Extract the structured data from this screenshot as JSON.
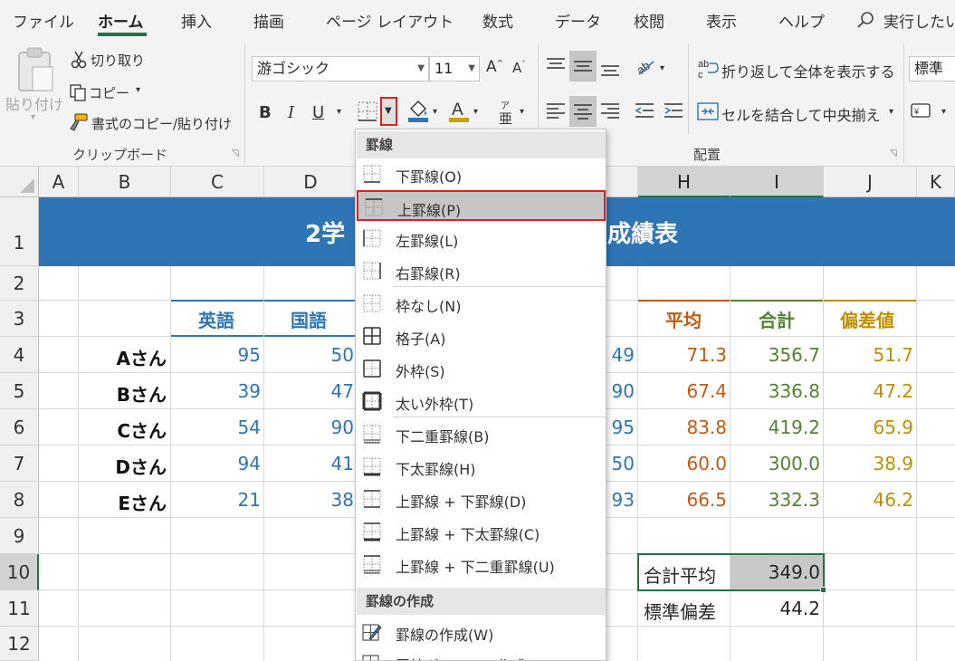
{
  "menu": {
    "tabs": [
      "ファイル",
      "ホーム",
      "挿入",
      "描画",
      "ページ レイアウト",
      "数式",
      "データ",
      "校閲",
      "表示",
      "ヘルプ"
    ],
    "active_tab": "ホーム",
    "tell_me": "実行したい"
  },
  "ribbon": {
    "clipboard": {
      "paste": "貼り付け",
      "cut": "切り取り",
      "copy": "コピー",
      "format_painter": "書式のコピー/貼り付け",
      "group_label": "クリップボード"
    },
    "font": {
      "name": "游ゴシック",
      "size": "11",
      "bold": "B",
      "italic": "I",
      "underline": "U",
      "phonetic": "亜"
    },
    "alignment": {
      "wrap_text": "折り返して全体を表示する",
      "merge_center": "セルを結合して中央揃え",
      "group_label": "配置"
    },
    "number": {
      "format": "標準"
    }
  },
  "columns": [
    "A",
    "B",
    "C",
    "D",
    "H",
    "I",
    "J",
    "K"
  ],
  "rows": [
    "1",
    "2",
    "3",
    "4",
    "5",
    "6",
    "7",
    "8",
    "9",
    "10",
    "11",
    "12"
  ],
  "sheet": {
    "title_left": "2学",
    "title_right": "成績表",
    "headers": {
      "english": "英語",
      "japanese": "国語",
      "avg": "平均",
      "total": "合計",
      "dev": "偏差値"
    },
    "students": [
      {
        "name": "Aさん",
        "english": "95",
        "japanese": "50",
        "col_g": "49",
        "avg": "71.3",
        "total": "356.7",
        "dev": "51.7"
      },
      {
        "name": "Bさん",
        "english": "39",
        "japanese": "47",
        "col_g": "90",
        "avg": "67.4",
        "total": "336.8",
        "dev": "47.2"
      },
      {
        "name": "Cさん",
        "english": "54",
        "japanese": "90",
        "col_g": "95",
        "avg": "83.8",
        "total": "419.2",
        "dev": "65.9"
      },
      {
        "name": "Dさん",
        "english": "94",
        "japanese": "41",
        "col_g": "50",
        "avg": "60.0",
        "total": "300.0",
        "dev": "38.9"
      },
      {
        "name": "Eさん",
        "english": "21",
        "japanese": "38",
        "col_g": "93",
        "avg": "66.5",
        "total": "332.3",
        "dev": "46.2"
      }
    ],
    "summary": [
      {
        "label": "合計平均",
        "value": "349.0"
      },
      {
        "label": "標準偏差",
        "value": "44.2"
      }
    ]
  },
  "border_menu": {
    "section1": "罫線",
    "items": [
      "下罫線(O)",
      "上罫線(P)",
      "左罫線(L)",
      "右罫線(R)",
      "枠なし(N)",
      "格子(A)",
      "外枠(S)",
      "太い外枠(T)",
      "下二重罫線(B)",
      "下太罫線(H)",
      "上罫線 + 下罫線(D)",
      "上罫線 + 下太罫線(C)",
      "上罫線 + 下二重罫線(U)"
    ],
    "highlighted": "上罫線(P)",
    "section2": "罫線の作成",
    "draw_items": [
      "罫線の作成(W)",
      "罫線グリッドの作成(G)"
    ]
  },
  "colors": {
    "accent": "#217346",
    "title_band": "#2e75b6",
    "english_header": "#2e75b6",
    "avg_header": "#c55a11",
    "total_header": "#548235",
    "dev_header": "#bf8f00",
    "highlight_border": "#e02020"
  }
}
